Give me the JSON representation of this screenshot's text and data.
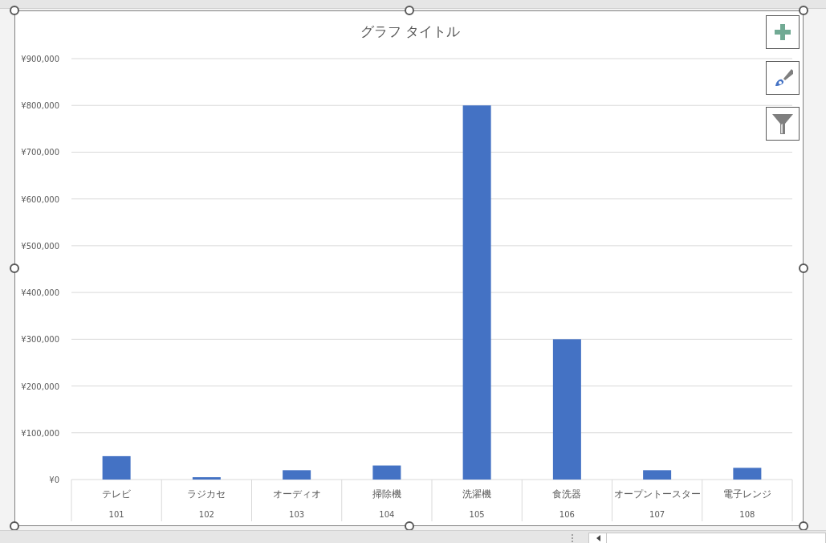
{
  "chart": {
    "chart_data": {
      "type": "bar",
      "title": "グラフ タイトル",
      "grid": true,
      "categories": [
        "テレビ",
        "ラジカセ",
        "オーディオ",
        "掃除機",
        "洗濯機",
        "食洗器",
        "オープントースター",
        "電子レンジ"
      ],
      "series": [
        {
          "color": "#4472c4",
          "values": [
            50000,
            5000,
            20000,
            30000,
            800000,
            300000,
            20000,
            25000
          ]
        }
      ],
      "ylim": [
        0,
        900000
      ],
      "yticks": [
        {
          "value": 0,
          "label": "¥0"
        },
        {
          "value": 100000,
          "label": "¥100,000"
        },
        {
          "value": 200000,
          "label": "¥200,000"
        },
        {
          "value": 300000,
          "label": "¥300,000"
        },
        {
          "value": 400000,
          "label": "¥400,000"
        },
        {
          "value": 500000,
          "label": "¥500,000"
        },
        {
          "value": 600000,
          "label": "¥600,000"
        },
        {
          "value": 700000,
          "label": "¥700,000"
        },
        {
          "value": 800000,
          "label": "¥800,000"
        },
        {
          "value": 900000,
          "label": "¥900,000"
        }
      ]
    },
    "category_codes": [
      "101",
      "102",
      "103",
      "104",
      "105",
      "106",
      "107",
      "108"
    ]
  }
}
